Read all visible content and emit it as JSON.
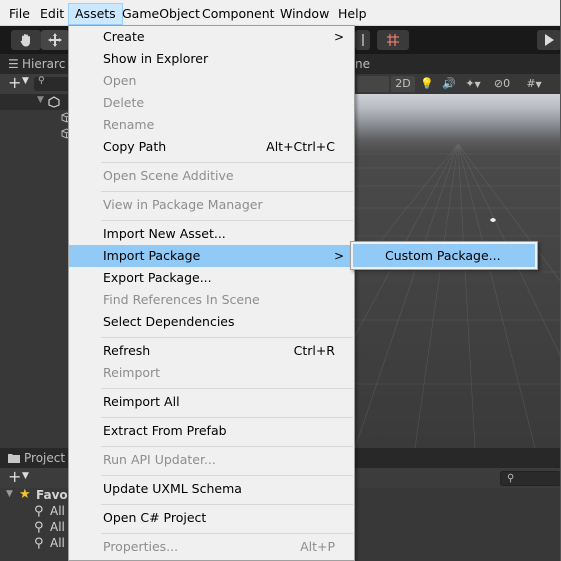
{
  "menubar": {
    "items": [
      {
        "label": "File"
      },
      {
        "label": "Edit"
      },
      {
        "label": "Assets"
      },
      {
        "label": "GameObject"
      },
      {
        "label": "Component"
      },
      {
        "label": "Window"
      },
      {
        "label": "Help"
      }
    ]
  },
  "hierarchy": {
    "tab_label": "Hierarc"
  },
  "scene": {
    "tab_label": "ne",
    "mode_2d": "2D",
    "hidden_count": "0"
  },
  "project": {
    "tab_label": "Project",
    "favorites_label": "Favor",
    "favorite_items": [
      "All",
      "All",
      "All"
    ]
  },
  "assets_menu": {
    "items": [
      {
        "label": "Create",
        "shortcut": "",
        "submenu": true,
        "disabled": false
      },
      {
        "label": "Show in Explorer",
        "shortcut": "",
        "submenu": false,
        "disabled": false
      },
      {
        "label": "Open",
        "shortcut": "",
        "submenu": false,
        "disabled": true
      },
      {
        "label": "Delete",
        "shortcut": "",
        "submenu": false,
        "disabled": true
      },
      {
        "label": "Rename",
        "shortcut": "",
        "submenu": false,
        "disabled": true
      },
      {
        "label": "Copy Path",
        "shortcut": "Alt+Ctrl+C",
        "submenu": false,
        "disabled": false
      },
      {
        "label": "Open Scene Additive",
        "shortcut": "",
        "submenu": false,
        "disabled": true
      },
      {
        "label": "View in Package Manager",
        "shortcut": "",
        "submenu": false,
        "disabled": true
      },
      {
        "label": "Import New Asset...",
        "shortcut": "",
        "submenu": false,
        "disabled": false
      },
      {
        "label": "Import Package",
        "shortcut": "",
        "submenu": true,
        "disabled": false,
        "highlighted": true
      },
      {
        "label": "Export Package...",
        "shortcut": "",
        "submenu": false,
        "disabled": false
      },
      {
        "label": "Find References In Scene",
        "shortcut": "",
        "submenu": false,
        "disabled": true
      },
      {
        "label": "Select Dependencies",
        "shortcut": "",
        "submenu": false,
        "disabled": false
      },
      {
        "label": "Refresh",
        "shortcut": "Ctrl+R",
        "submenu": false,
        "disabled": false
      },
      {
        "label": "Reimport",
        "shortcut": "",
        "submenu": false,
        "disabled": true
      },
      {
        "label": "Reimport All",
        "shortcut": "",
        "submenu": false,
        "disabled": false
      },
      {
        "label": "Extract From Prefab",
        "shortcut": "",
        "submenu": false,
        "disabled": false
      },
      {
        "label": "Run API Updater...",
        "shortcut": "",
        "submenu": false,
        "disabled": true
      },
      {
        "label": "Update UXML Schema",
        "shortcut": "",
        "submenu": false,
        "disabled": false
      },
      {
        "label": "Open C# Project",
        "shortcut": "",
        "submenu": false,
        "disabled": false
      },
      {
        "label": "Properties...",
        "shortcut": "Alt+P",
        "submenu": false,
        "disabled": true
      }
    ],
    "submenu_arrow": ">"
  },
  "import_package_submenu": {
    "items": [
      {
        "label": "Custom Package..."
      }
    ]
  },
  "colors": {
    "menu_highlight": "#91c9f7",
    "menubar_active": "#cce8ff",
    "disabled_text": "#8d8d8d",
    "editor_dark": "#383838"
  }
}
